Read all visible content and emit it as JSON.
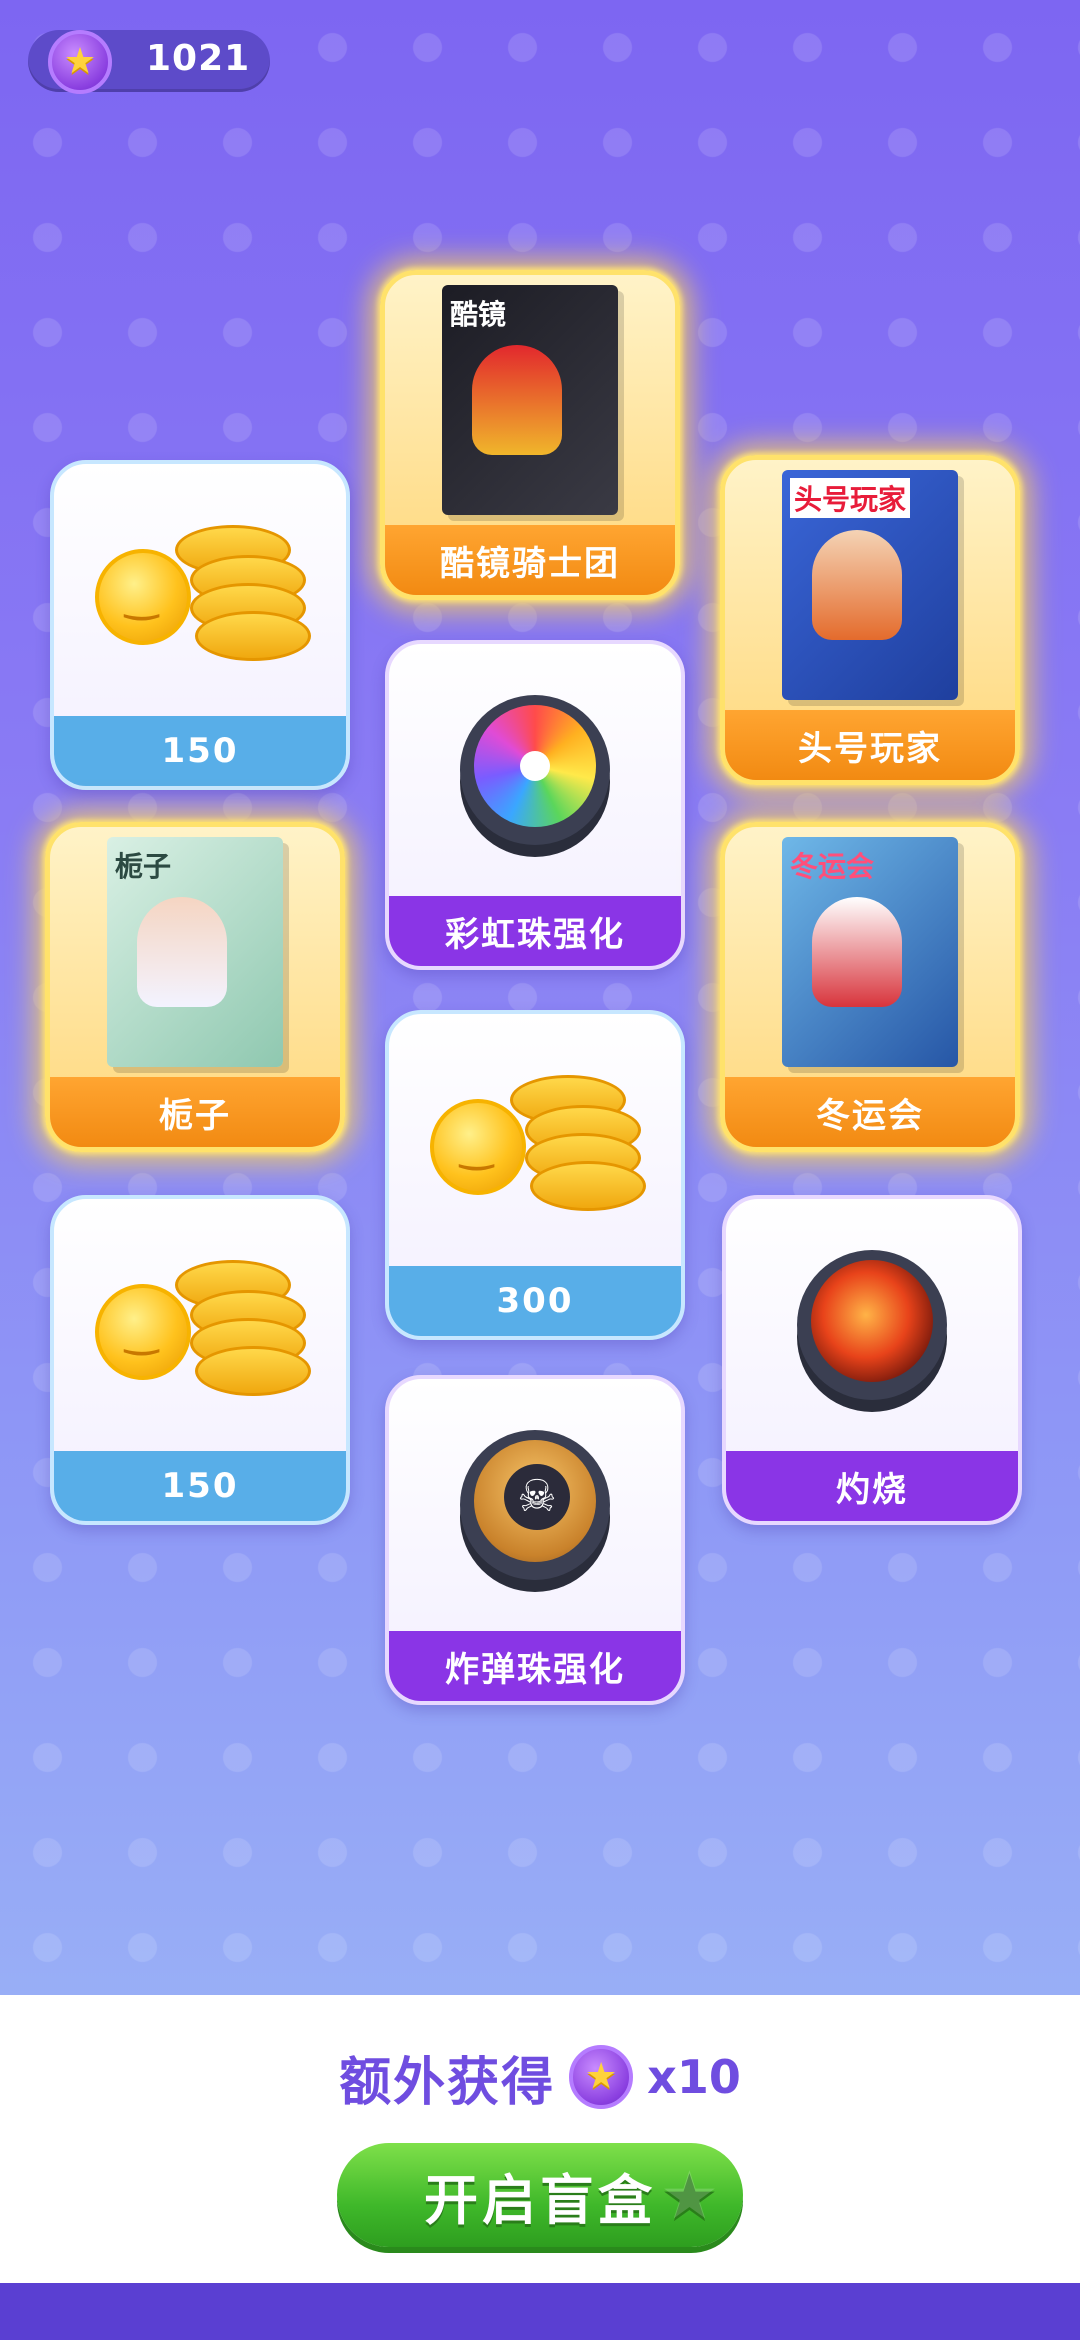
{
  "header": {
    "coin_balance": "1021",
    "coin_icon": "star-coin-icon"
  },
  "grid": {
    "items": [
      {
        "label": "酷镜骑士团",
        "type": "blind-box",
        "style": "gold",
        "box_title": "酷镜"
      },
      {
        "label": "150",
        "type": "coins",
        "style": "blue"
      },
      {
        "label": "头号玩家",
        "type": "blind-box",
        "style": "gold",
        "box_title": "头号玩家"
      },
      {
        "label": "彩虹珠强化",
        "type": "puck",
        "style": "purple"
      },
      {
        "label": "栀子",
        "type": "blind-box",
        "style": "gold",
        "box_title": "栀子"
      },
      {
        "label": "冬运会",
        "type": "blind-box",
        "style": "gold",
        "box_title": "冬运会"
      },
      {
        "label": "300",
        "type": "coins",
        "style": "blue"
      },
      {
        "label": "150",
        "type": "coins",
        "style": "blue"
      },
      {
        "label": "灼烧",
        "type": "puck",
        "style": "purple"
      },
      {
        "label": "炸弹珠强化",
        "type": "puck",
        "style": "purple"
      }
    ]
  },
  "footer": {
    "bonus_text": "额外获得",
    "bonus_multiplier": "x10",
    "open_button_label": "开启盲盒"
  }
}
